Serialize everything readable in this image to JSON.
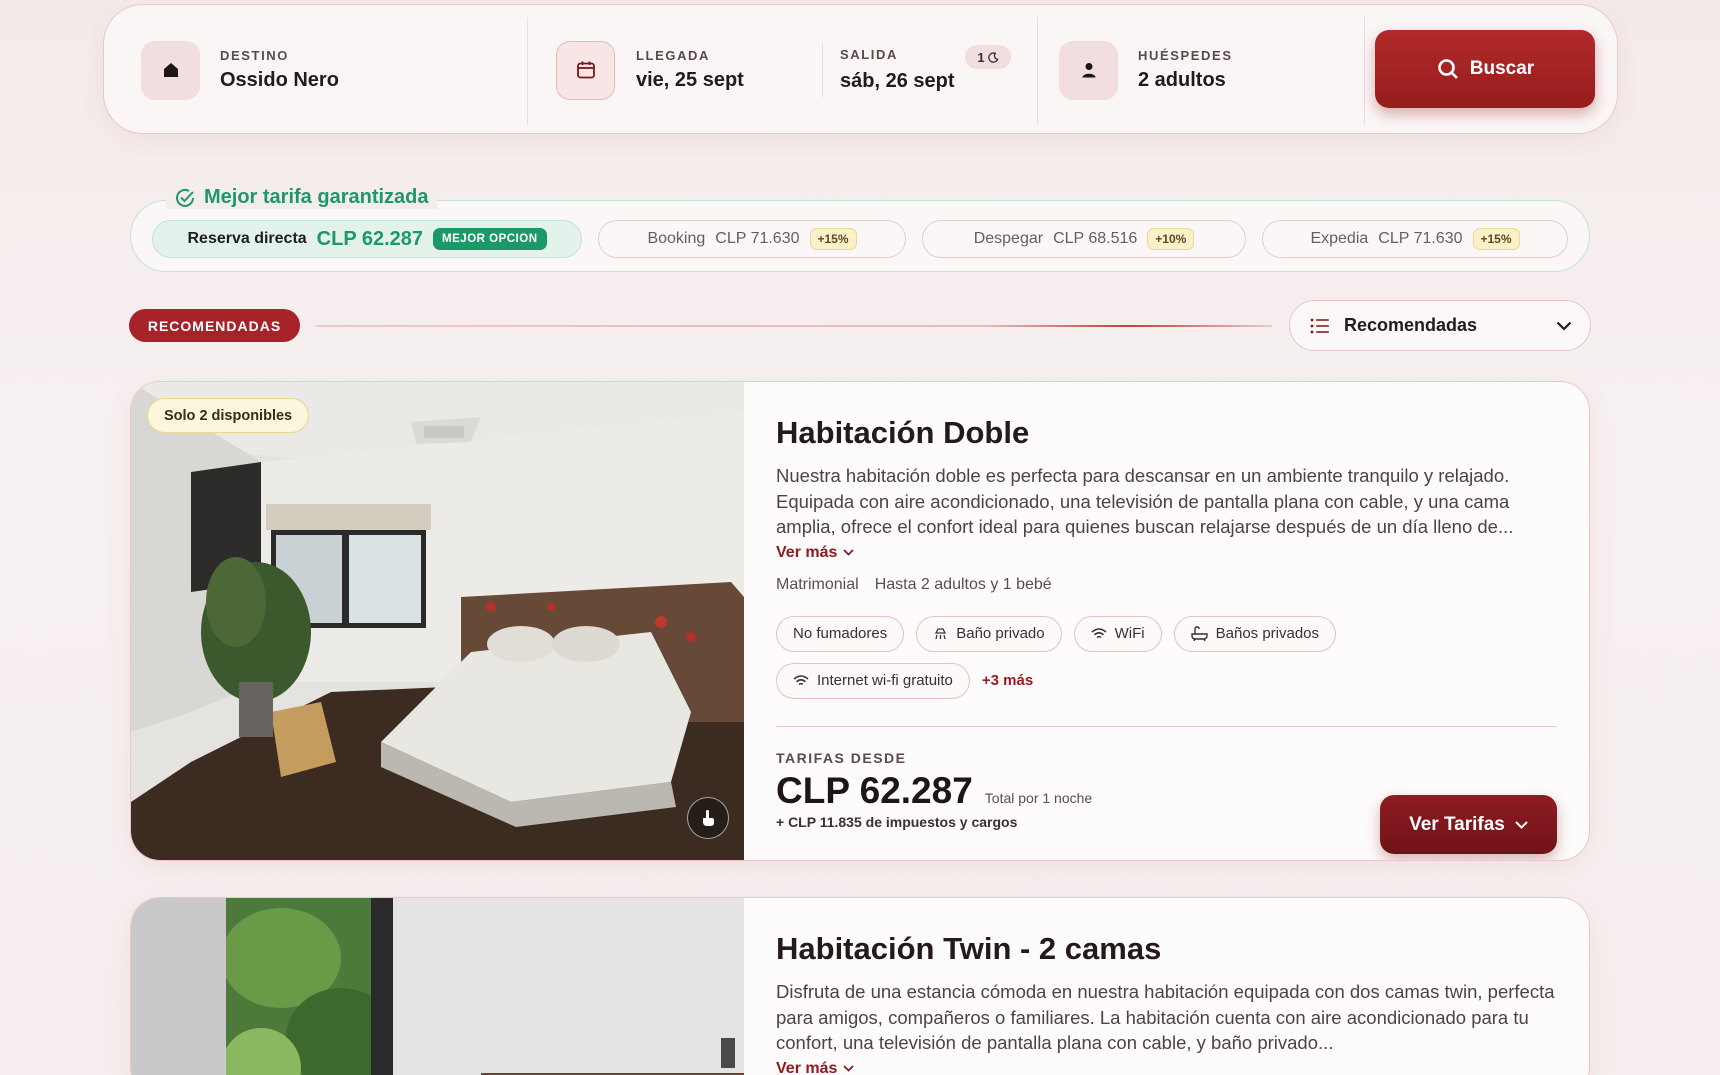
{
  "search": {
    "destination_label": "DESTINO",
    "destination_value": "Ossido Nero",
    "arrival_label": "LLEGADA",
    "arrival_value": "vie, 25 sept",
    "departure_label": "SALIDA",
    "departure_value": "sáb, 26 sept",
    "nights": "1",
    "guests_label": "HUÉSPEDES",
    "guests_value": "2 adultos",
    "button_label": "Buscar",
    "icons": [
      "home-icon",
      "calendar-icon",
      "moon-icon",
      "person-icon",
      "search-icon"
    ]
  },
  "best_rate": {
    "title": "Mejor tarifa garantizada",
    "direct": {
      "label": "Reserva directa",
      "price": "CLP 62.287",
      "badge": "MEJOR OPCION"
    },
    "competitors": [
      {
        "name": "Booking",
        "price": "CLP 71.630",
        "diff": "+15%"
      },
      {
        "name": "Despegar",
        "price": "CLP 68.516",
        "diff": "+10%"
      },
      {
        "name": "Expedia",
        "price": "CLP 71.630",
        "diff": "+15%"
      }
    ]
  },
  "section": {
    "badge": "RECOMENDADAS",
    "sort_value": "Recomendadas"
  },
  "rooms": [
    {
      "availability": "Solo 2 disponibles",
      "title": "Habitación Doble",
      "description": "Nuestra habitación doble es perfecta para descansar en un ambiente tranquilo y relajado. Equipada con aire acondicionado, una televisión de pantalla plana con cable, y una cama amplia, ofrece el confort ideal para quienes buscan relajarse después de un día lleno de...",
      "more_label": "Ver más",
      "bed": "Matrimonial",
      "capacity": "Hasta 2 adultos y 1 bebé",
      "amenities": [
        "No fumadores",
        "Baño privado",
        "WiFi",
        "Baños privados",
        "Internet wi-fi gratuito"
      ],
      "more_amenities": "+3 más",
      "rates_label": "TARIFAS DESDE",
      "price": "CLP 62.287",
      "price_note": "Total por 1 noche",
      "taxes": "+ CLP 11.835 de impuestos y cargos",
      "cta": "Ver Tarifas"
    },
    {
      "title": "Habitación Twin - 2 camas",
      "description": "Disfruta de una estancia cómoda en nuestra habitación equipada con dos camas twin, perfecta para amigos, compañeros o familiares. La habitación cuenta con aire acondicionado para tu confort, una televisión de pantalla plana con cable, y baño privado...",
      "more_label": "Ver más"
    }
  ],
  "colors": {
    "brand": "#a8222a",
    "brand_dark": "#7a161b",
    "success": "#1c9a66",
    "background": "#f5ecec"
  }
}
